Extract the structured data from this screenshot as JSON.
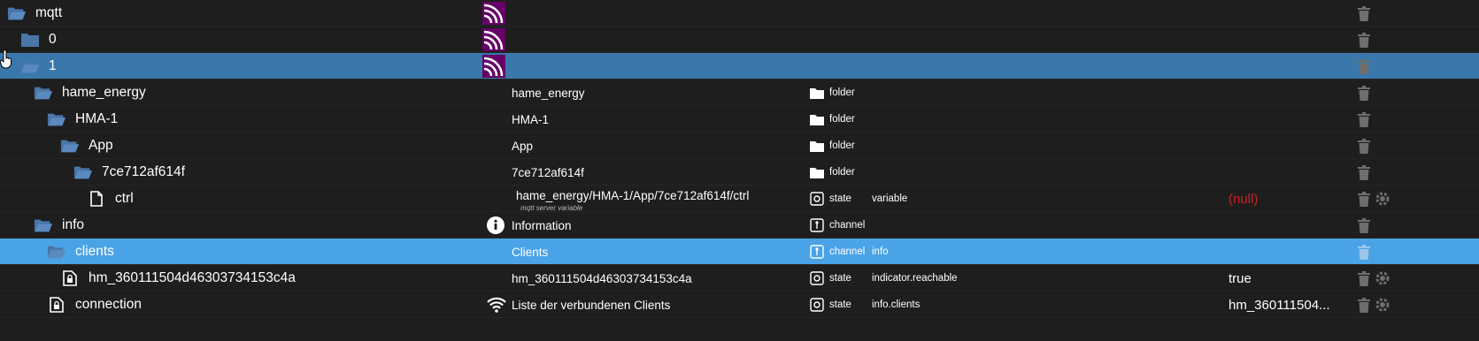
{
  "colors": {
    "background": "#1e1e1e",
    "selected_dark": "#3a78ac",
    "selected_light": "#4aa3e6",
    "folder_icon": "#4a76a8",
    "null_value": "#cc2222",
    "trash": "#6e6e6e",
    "mqtt_logo_bg": "#660066"
  },
  "rows": [
    {
      "name": "mqtt",
      "icon": "folder-open-icon",
      "label_icon": "mqtt-logo-icon"
    },
    {
      "name": "0",
      "icon": "folder-closed-icon",
      "label_icon": "mqtt-logo-icon"
    },
    {
      "name": "1",
      "icon": "folder-open-icon",
      "label_icon": "mqtt-logo-icon",
      "selected": true
    },
    {
      "name": "hame_energy",
      "icon": "folder-open-icon",
      "label": "hame_energy",
      "type": "folder",
      "type_icon": "folder-icon"
    },
    {
      "name": "HMA-1",
      "icon": "folder-open-icon",
      "label": "HMA-1",
      "type": "folder",
      "type_icon": "folder-icon"
    },
    {
      "name": "App",
      "icon": "folder-open-icon",
      "label": "App",
      "type": "folder",
      "type_icon": "folder-icon"
    },
    {
      "name": "7ce712af614f",
      "icon": "folder-open-icon",
      "label": "7ce712af614f",
      "type": "folder",
      "type_icon": "folder-icon"
    },
    {
      "name": "ctrl",
      "icon": "file-icon",
      "label": "hame_energy/HMA-1/App/7ce712af614f/ctrl",
      "label_sub": "mqtt server variable",
      "type": "state",
      "type_icon": "state-icon",
      "role": "variable",
      "value": "(null)"
    },
    {
      "name": "info",
      "icon": "folder-open-icon",
      "label": "Information",
      "label_icon": "info-icon",
      "type": "channel",
      "type_icon": "channel-icon"
    },
    {
      "name": "clients",
      "icon": "folder-open-icon",
      "label": "Clients",
      "type": "channel",
      "type_icon": "channel-icon",
      "role": "info",
      "selected": true
    },
    {
      "name": "hm_360111504d46303734153c4a",
      "icon": "lock-file-icon",
      "label": "hm_360111504d46303734153c4a",
      "type": "state",
      "type_icon": "state-icon",
      "role": "indicator.reachable",
      "value": "true"
    },
    {
      "name": "connection",
      "icon": "lock-file-icon",
      "label": "Liste der verbundenen Clients",
      "label_icon": "wifi-icon",
      "type": "state",
      "type_icon": "state-icon",
      "role": "info.clients",
      "value": "hm_360111504..."
    }
  ]
}
